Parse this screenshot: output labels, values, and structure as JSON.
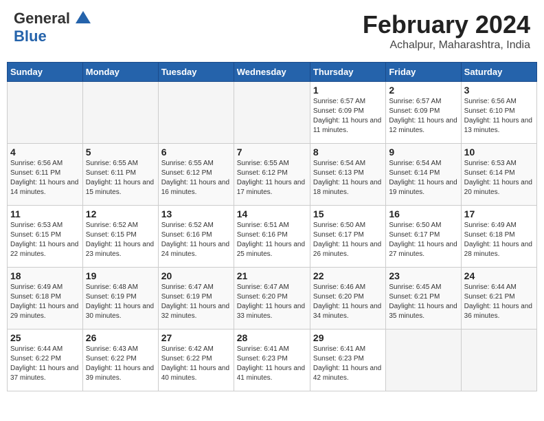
{
  "header": {
    "logo_general": "General",
    "logo_blue": "Blue",
    "title": "February 2024",
    "subtitle": "Achalpur, Maharashtra, India"
  },
  "days_of_week": [
    "Sunday",
    "Monday",
    "Tuesday",
    "Wednesday",
    "Thursday",
    "Friday",
    "Saturday"
  ],
  "weeks": [
    [
      {
        "num": "",
        "info": "",
        "empty": true
      },
      {
        "num": "",
        "info": "",
        "empty": true
      },
      {
        "num": "",
        "info": "",
        "empty": true
      },
      {
        "num": "",
        "info": "",
        "empty": true
      },
      {
        "num": "1",
        "info": "Sunrise: 6:57 AM\nSunset: 6:09 PM\nDaylight: 11 hours and 11 minutes."
      },
      {
        "num": "2",
        "info": "Sunrise: 6:57 AM\nSunset: 6:09 PM\nDaylight: 11 hours and 12 minutes."
      },
      {
        "num": "3",
        "info": "Sunrise: 6:56 AM\nSunset: 6:10 PM\nDaylight: 11 hours and 13 minutes."
      }
    ],
    [
      {
        "num": "4",
        "info": "Sunrise: 6:56 AM\nSunset: 6:11 PM\nDaylight: 11 hours and 14 minutes."
      },
      {
        "num": "5",
        "info": "Sunrise: 6:55 AM\nSunset: 6:11 PM\nDaylight: 11 hours and 15 minutes."
      },
      {
        "num": "6",
        "info": "Sunrise: 6:55 AM\nSunset: 6:12 PM\nDaylight: 11 hours and 16 minutes."
      },
      {
        "num": "7",
        "info": "Sunrise: 6:55 AM\nSunset: 6:12 PM\nDaylight: 11 hours and 17 minutes."
      },
      {
        "num": "8",
        "info": "Sunrise: 6:54 AM\nSunset: 6:13 PM\nDaylight: 11 hours and 18 minutes."
      },
      {
        "num": "9",
        "info": "Sunrise: 6:54 AM\nSunset: 6:14 PM\nDaylight: 11 hours and 19 minutes."
      },
      {
        "num": "10",
        "info": "Sunrise: 6:53 AM\nSunset: 6:14 PM\nDaylight: 11 hours and 20 minutes."
      }
    ],
    [
      {
        "num": "11",
        "info": "Sunrise: 6:53 AM\nSunset: 6:15 PM\nDaylight: 11 hours and 22 minutes."
      },
      {
        "num": "12",
        "info": "Sunrise: 6:52 AM\nSunset: 6:15 PM\nDaylight: 11 hours and 23 minutes."
      },
      {
        "num": "13",
        "info": "Sunrise: 6:52 AM\nSunset: 6:16 PM\nDaylight: 11 hours and 24 minutes."
      },
      {
        "num": "14",
        "info": "Sunrise: 6:51 AM\nSunset: 6:16 PM\nDaylight: 11 hours and 25 minutes."
      },
      {
        "num": "15",
        "info": "Sunrise: 6:50 AM\nSunset: 6:17 PM\nDaylight: 11 hours and 26 minutes."
      },
      {
        "num": "16",
        "info": "Sunrise: 6:50 AM\nSunset: 6:17 PM\nDaylight: 11 hours and 27 minutes."
      },
      {
        "num": "17",
        "info": "Sunrise: 6:49 AM\nSunset: 6:18 PM\nDaylight: 11 hours and 28 minutes."
      }
    ],
    [
      {
        "num": "18",
        "info": "Sunrise: 6:49 AM\nSunset: 6:18 PM\nDaylight: 11 hours and 29 minutes."
      },
      {
        "num": "19",
        "info": "Sunrise: 6:48 AM\nSunset: 6:19 PM\nDaylight: 11 hours and 30 minutes."
      },
      {
        "num": "20",
        "info": "Sunrise: 6:47 AM\nSunset: 6:19 PM\nDaylight: 11 hours and 32 minutes."
      },
      {
        "num": "21",
        "info": "Sunrise: 6:47 AM\nSunset: 6:20 PM\nDaylight: 11 hours and 33 minutes."
      },
      {
        "num": "22",
        "info": "Sunrise: 6:46 AM\nSunset: 6:20 PM\nDaylight: 11 hours and 34 minutes."
      },
      {
        "num": "23",
        "info": "Sunrise: 6:45 AM\nSunset: 6:21 PM\nDaylight: 11 hours and 35 minutes."
      },
      {
        "num": "24",
        "info": "Sunrise: 6:44 AM\nSunset: 6:21 PM\nDaylight: 11 hours and 36 minutes."
      }
    ],
    [
      {
        "num": "25",
        "info": "Sunrise: 6:44 AM\nSunset: 6:22 PM\nDaylight: 11 hours and 37 minutes."
      },
      {
        "num": "26",
        "info": "Sunrise: 6:43 AM\nSunset: 6:22 PM\nDaylight: 11 hours and 39 minutes."
      },
      {
        "num": "27",
        "info": "Sunrise: 6:42 AM\nSunset: 6:22 PM\nDaylight: 11 hours and 40 minutes."
      },
      {
        "num": "28",
        "info": "Sunrise: 6:41 AM\nSunset: 6:23 PM\nDaylight: 11 hours and 41 minutes."
      },
      {
        "num": "29",
        "info": "Sunrise: 6:41 AM\nSunset: 6:23 PM\nDaylight: 11 hours and 42 minutes."
      },
      {
        "num": "",
        "info": "",
        "empty": true
      },
      {
        "num": "",
        "info": "",
        "empty": true
      }
    ]
  ]
}
